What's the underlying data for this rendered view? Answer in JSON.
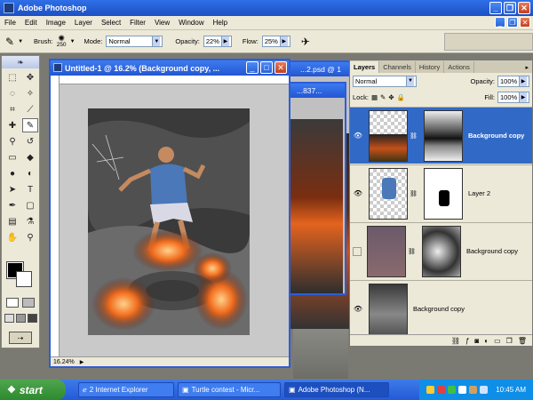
{
  "app": {
    "title": "Adobe Photoshop"
  },
  "menu": [
    "File",
    "Edit",
    "Image",
    "Layer",
    "Select",
    "Filter",
    "View",
    "Window",
    "Help"
  ],
  "options": {
    "brush_label": "Brush:",
    "brush_size": "250",
    "mode_label": "Mode:",
    "mode_value": "Normal",
    "opacity_label": "Opacity:",
    "opacity_value": "22%",
    "flow_label": "Flow:",
    "flow_value": "25%"
  },
  "documents": {
    "main_title": "Untitled-1 @ 16.2% (Background copy, ...",
    "main_zoom": "16.24%",
    "bg_doc_1": "...2.psd @ 1",
    "bg_doc_2": "...837..."
  },
  "layers_panel": {
    "tabs": [
      "Layers",
      "Channels",
      "History",
      "Actions"
    ],
    "blend_mode": "Normal",
    "opacity_label": "Opacity:",
    "opacity_value": "100%",
    "lock_label": "Lock:",
    "fill_label": "Fill:",
    "fill_value": "100%",
    "layers": [
      {
        "name": "Background copy",
        "selected": true
      },
      {
        "name": "Layer 2",
        "selected": false
      },
      {
        "name": "Background copy",
        "selected": false
      },
      {
        "name": "Background copy",
        "selected": false
      }
    ]
  },
  "taskbar": {
    "start": "start",
    "buttons": [
      "2 Internet Explorer",
      "Turtle contest - Micr...",
      "Adobe Photoshop (N..."
    ],
    "clock": "10:45 AM"
  },
  "colors": {
    "title_blue": "#2356d2",
    "selected_layer": "#3169c6",
    "taskbar": "#245ad6"
  }
}
